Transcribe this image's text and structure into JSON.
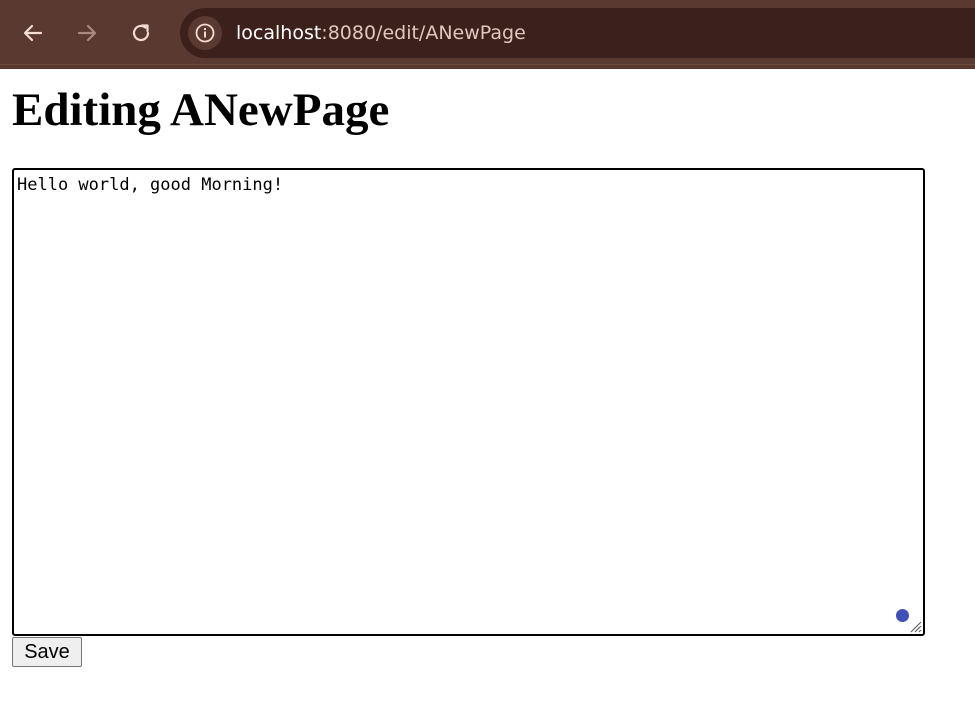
{
  "browser": {
    "url_host": "localhost",
    "url_rest": ":8080/edit/ANewPage",
    "icons": {
      "back": "back-arrow-icon",
      "forward": "forward-arrow-icon",
      "reload": "reload-icon",
      "site_info": "info-icon"
    },
    "toolbar_color": "#5a3a30",
    "omnibox_color": "#3c201b"
  },
  "page": {
    "title": "Editing ANewPage",
    "editor_value": "Hello world, good Morning!",
    "save_label": "Save"
  }
}
